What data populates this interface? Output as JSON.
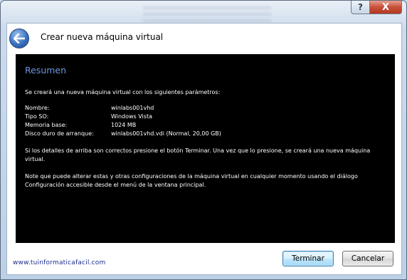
{
  "window": {
    "title": "Crear nueva máquina virtual",
    "help_glyph": "?",
    "close_glyph": "X",
    "back_icon": "back-arrow-icon"
  },
  "summary": {
    "heading": "Resumen",
    "intro": "Se creará una nueva máquina virtual con los siguientes parámetros:",
    "params": [
      {
        "key": "Nombre:",
        "value": "winlabs001vhd"
      },
      {
        "key": "Tipo SO:",
        "value": "Windows Vista"
      },
      {
        "key": "Memoria base:",
        "value": "1024 MB"
      },
      {
        "key": "Disco duro de arranque:",
        "value": "winlabs001vhd.vdi (Normal, 20,00 GB)"
      }
    ],
    "note1": "Si los detalles de arriba son correctos presione el botón Terminar. Una vez que lo presione, se creará una nueva máquina virtual.",
    "note2": "Note que puede alterar estas y otras configuraciones de la máquina virtual en cualquier momento usando el diálogo Configuración accesible desde el menú de la ventana principal."
  },
  "footer": {
    "watermark": "www.tuinformaticafacil.com",
    "finish_label": "Terminar",
    "cancel_label": "Cancelar"
  },
  "colors": {
    "heading": "#6d96e0",
    "summary_bg": "#000000",
    "watermark": "#1b2e8f"
  }
}
